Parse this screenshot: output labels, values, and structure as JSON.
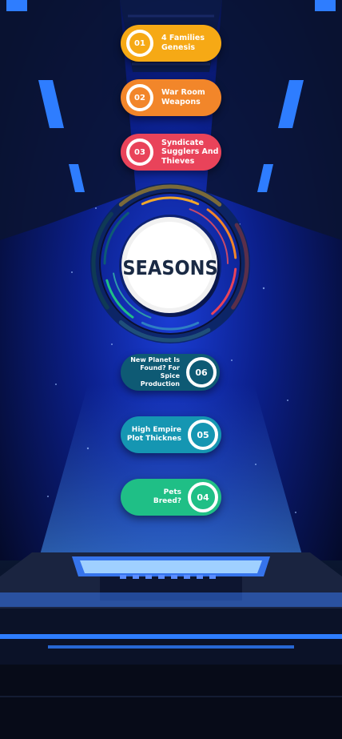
{
  "center": {
    "title": "SEASONS"
  },
  "items": [
    {
      "number": "01",
      "label_line1": "4 Families",
      "label_line2": "Genesis",
      "label_line3": "",
      "color": "#f6a915"
    },
    {
      "number": "02",
      "label_line1": "War Room",
      "label_line2": "Weapons",
      "label_line3": "",
      "color": "#f2862a"
    },
    {
      "number": "03",
      "label_line1": "Syndicate",
      "label_line2": "Sugglers And",
      "label_line3": "Thieves",
      "color": "#e9435a"
    },
    {
      "number": "06",
      "label_line1": "New Planet Is",
      "label_line2": "Found? For Spice",
      "label_line3": "Production",
      "color": "#0e5a74"
    },
    {
      "number": "05",
      "label_line1": "High Empire",
      "label_line2": "Plot Thicknes",
      "label_line3": "",
      "color": "#1596b2"
    },
    {
      "number": "04",
      "label_line1": "Pets",
      "label_line2": "Breed?",
      "label_line3": "",
      "color": "#1fbf86"
    }
  ],
  "ring_colors": [
    "#f2a72a",
    "#f2862a",
    "#e9435a",
    "#2f7fc4",
    "#1fbf86",
    "#0e5a74"
  ]
}
